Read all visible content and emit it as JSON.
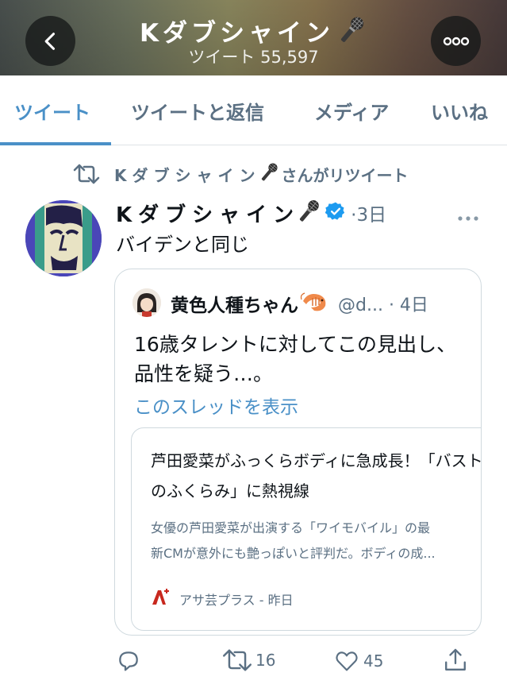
{
  "header": {
    "name": "Kダブシャイン",
    "tweet_count": "ツイート 55,597",
    "colors": {
      "banner_left": "#4b5250",
      "banner_mid": "#8d8a60",
      "banner_right": "#4a3c3c"
    }
  },
  "tabs": [
    {
      "label": "ツイート",
      "active": true
    },
    {
      "label": "ツイートと返信",
      "active": false
    },
    {
      "label": "メディア",
      "active": false
    },
    {
      "label": "いいね",
      "active": false
    }
  ],
  "tweet": {
    "retweet_label_name": "Kダブシャイン",
    "retweet_label_suffix": "さんがリツイート",
    "author_name": "Kダブシャイン",
    "time": "·3日",
    "text": "バイデンと同じ",
    "quote": {
      "name": "黄色人種ちゃん",
      "handle": "@d... · 4日",
      "text": "16歳タレントに対してこの見出し、品性を疑う…。",
      "thread_link": "このスレッドを表示",
      "link_card": {
        "title": "芦田愛菜がふっくらボディに急成長！「バストのふくらみ」に熱視線",
        "description_line1": "女優の芦田愛菜が出演する「ワイモバイル」の最",
        "description_line2": "新CMが意外にも艶っぽいと評判だ。ボディの成...",
        "source": "アサ芸プラス - 昨日"
      }
    },
    "actions": {
      "reply_count": "",
      "retweet_count": "16",
      "like_count": "45"
    }
  },
  "icons": {
    "back": "chevron-left-icon",
    "more": "more-horizontal-icon",
    "mic": "microphone-icon",
    "retweet": "retweet-icon",
    "verified": "verified-badge-icon",
    "reply": "reply-icon",
    "like": "heart-icon",
    "share": "share-icon"
  },
  "accent_color": "#4a90c7",
  "verified_color": "#1d9bf0"
}
